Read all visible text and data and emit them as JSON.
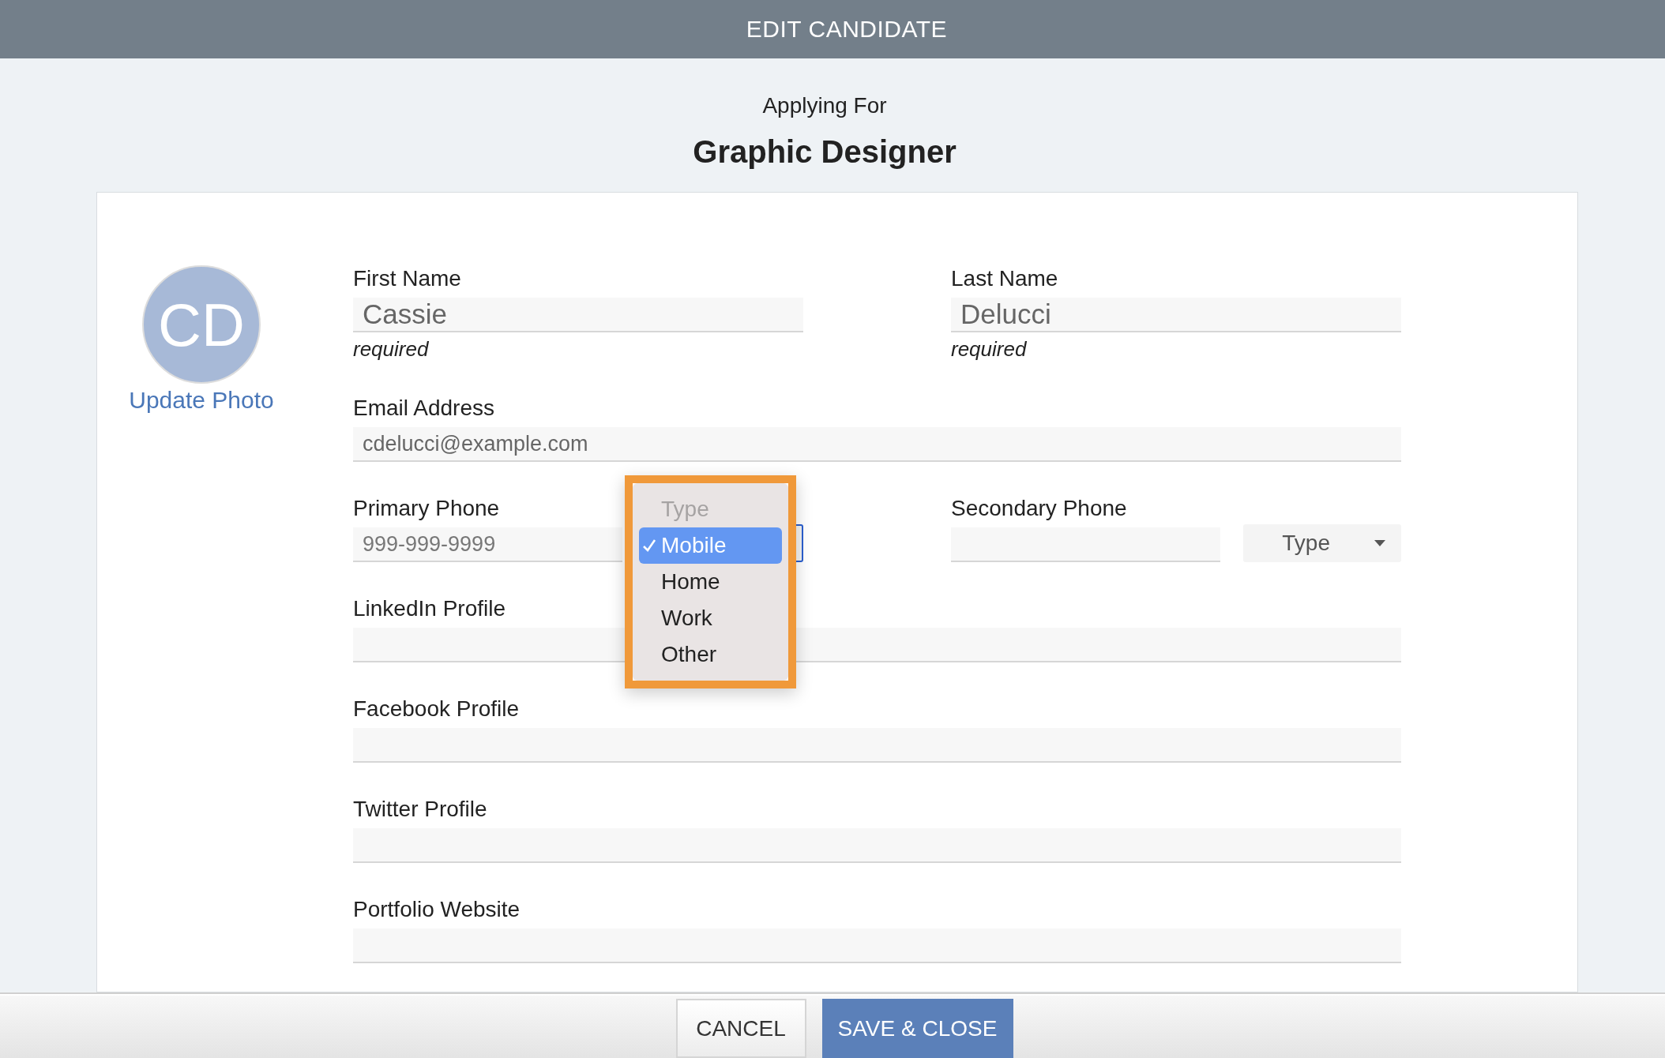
{
  "header": {
    "title": "EDIT CANDIDATE"
  },
  "applying_label": "Applying For",
  "job_title": "Graphic Designer",
  "avatar": {
    "initials": "CD",
    "link": "Update Photo"
  },
  "rows": [
    [
      {
        "kind": "name",
        "label": "First Name",
        "value": "Cassie",
        "note": "required"
      },
      {
        "kind": "name",
        "label": "Last Name",
        "value": "Delucci",
        "note": "required"
      }
    ],
    [
      {
        "kind": "text",
        "label": "Email Address",
        "value": "cdelucci@example.com"
      }
    ],
    [
      {
        "kind": "phone",
        "label": "Primary Phone",
        "placeholder": "999-999-9999",
        "type_select": {
          "open": true,
          "options": [
            {
              "label": "Type",
              "disabled": true,
              "selected": false
            },
            {
              "label": "Mobile",
              "disabled": false,
              "selected": true
            },
            {
              "label": "Home",
              "disabled": false,
              "selected": false
            },
            {
              "label": "Work",
              "disabled": false,
              "selected": false
            },
            {
              "label": "Other",
              "disabled": false,
              "selected": false
            }
          ]
        }
      },
      {
        "kind": "phone",
        "label": "Secondary Phone",
        "type_select": {
          "placeholder": "Type",
          "open": false
        }
      }
    ],
    [
      {
        "kind": "text",
        "label": "LinkedIn Profile"
      }
    ],
    [
      {
        "kind": "text",
        "label": "Facebook Profile"
      }
    ],
    [
      {
        "kind": "text",
        "label": "Twitter Profile"
      }
    ],
    [
      {
        "kind": "text",
        "label": "Portfolio Website"
      }
    ]
  ],
  "footer": {
    "buttons": [
      {
        "label": "CANCEL",
        "kind": "secondary"
      },
      {
        "label": "SAVE & CLOSE",
        "kind": "primary"
      }
    ]
  }
}
